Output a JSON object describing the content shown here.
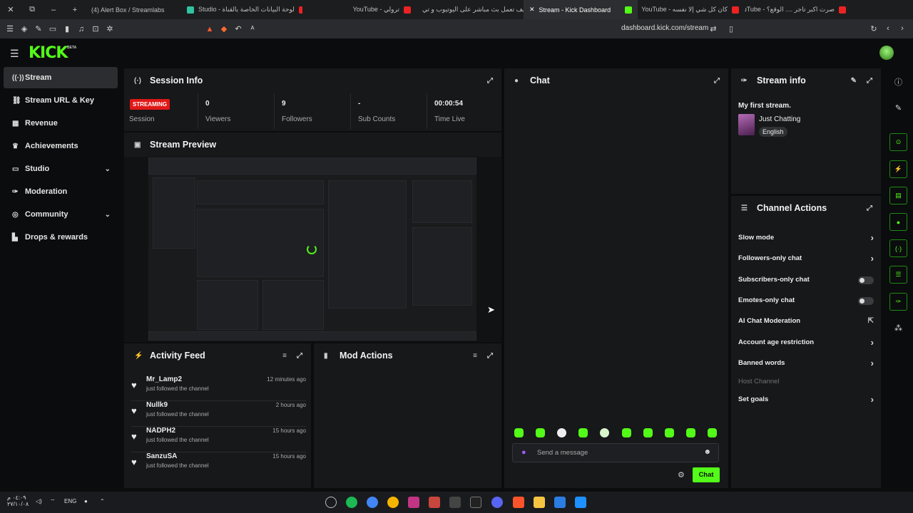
{
  "browser": {
    "tabs": [
      {
        "title": "(4) Alert Box / Streamlabs",
        "icon": "streamlabs-icon"
      },
      {
        "title": "Studio - لوحة البيانات الخاصة بالقناة",
        "icon": "youtube-icon"
      },
      {
        "title": "YouTube - ترولي",
        "icon": "youtube-icon"
      },
      {
        "title": "كيف تعمل بث مباشر على اليوتيوب و تي",
        "icon": "youtube-icon"
      },
      {
        "title": "Stream - Kick Dashboard",
        "icon": "kick-icon",
        "active": true
      },
      {
        "title": "YouTube - كان كل شي إلا نفسه",
        "icon": "youtube-icon"
      },
      {
        "title": "YouTube - صرت اكبر تاجر .... الوقع؟",
        "icon": "youtube-icon"
      }
    ],
    "url": "dashboard.kick.com/stream"
  },
  "header": {
    "logo": "KICK",
    "logo_badge": "BETA"
  },
  "sidebar": {
    "items": [
      {
        "label": "Stream",
        "icon": "broadcast-icon",
        "active": true
      },
      {
        "label": "Stream URL & Key",
        "icon": "link-icon"
      },
      {
        "label": "Revenue",
        "icon": "chart-icon"
      },
      {
        "label": "Achievements",
        "icon": "trophy-icon"
      },
      {
        "label": "Studio",
        "icon": "video-icon",
        "expandable": true
      },
      {
        "label": "Moderation",
        "icon": "wrench-icon"
      },
      {
        "label": "Community",
        "icon": "chat-icon",
        "expandable": true
      },
      {
        "label": "Drops & rewards",
        "icon": "gift-icon"
      }
    ]
  },
  "session_info": {
    "title": "Session Info",
    "status_badge": "STREAMING",
    "session_label": "Session",
    "stats": [
      {
        "value": "0",
        "label": "Viewers"
      },
      {
        "value": "9",
        "label": "Followers"
      },
      {
        "value": "-",
        "label": "Sub Counts"
      },
      {
        "value": "00:00:54",
        "label": "Time Live"
      }
    ]
  },
  "stream_preview": {
    "title": "Stream Preview"
  },
  "activity_feed": {
    "title": "Activity Feed",
    "items": [
      {
        "user": "Mr_Lamp2",
        "text": "just followed the channel",
        "time": "12 minutes ago"
      },
      {
        "user": "Nullk9",
        "text": "just followed the channel",
        "time": "2 hours ago"
      },
      {
        "user": "NADPH2",
        "text": "just followed the channel",
        "time": "15 hours ago"
      },
      {
        "user": "SanzuSA",
        "text": "just followed the channel",
        "time": "15 hours ago"
      }
    ]
  },
  "mod_actions": {
    "title": "Mod Actions"
  },
  "chat": {
    "title": "Chat",
    "input_placeholder": "Send a message",
    "send_label": "Chat"
  },
  "stream_info": {
    "title": "Stream info",
    "stream_title": "My first stream.",
    "category": "Just Chatting",
    "tag": "English"
  },
  "channel_actions": {
    "title": "Channel Actions",
    "items": [
      {
        "label": "Slow mode",
        "control": "arrow"
      },
      {
        "label": "Followers-only chat",
        "control": "arrow"
      },
      {
        "label": "Subscribers-only chat",
        "control": "toggle",
        "value": false
      },
      {
        "label": "Emotes-only chat",
        "control": "toggle",
        "value": false
      },
      {
        "label": "AI Chat Moderation",
        "control": "external"
      },
      {
        "label": "Account age restriction",
        "control": "arrow"
      },
      {
        "label": "Banned words",
        "control": "arrow"
      },
      {
        "label": "Host Channel",
        "control": "none",
        "disabled": true
      },
      {
        "label": "Set goals",
        "control": "arrow"
      }
    ]
  },
  "taskbar": {
    "time": "٠٤:٠٩ م",
    "date": "٢٧/١٠/٠٨",
    "language": "ENG"
  },
  "colors": {
    "accent": "#53fc18",
    "live_badge": "#e01717",
    "background": "#0b0c0d",
    "panel": "#17181a"
  }
}
